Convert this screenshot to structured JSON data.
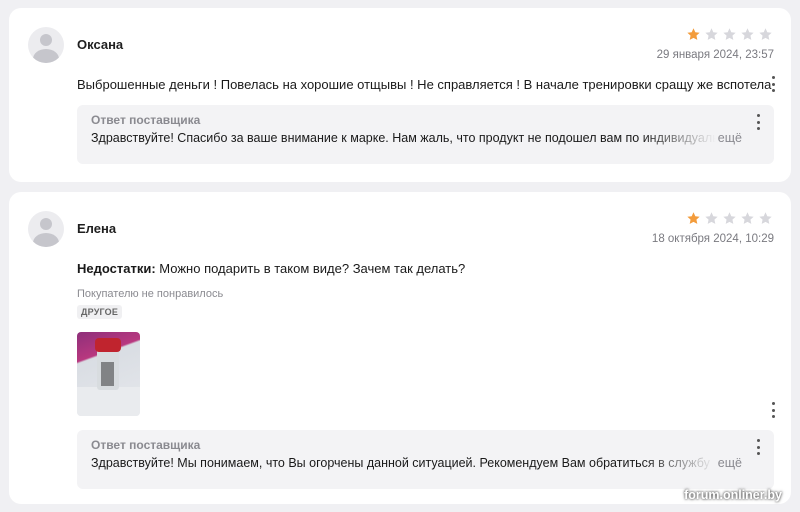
{
  "reviews": [
    {
      "author": "Оксана",
      "rating": 1,
      "max_rating": 5,
      "date": "29 января 2024, 23:57",
      "text": "Выброшенные деньги ! Повелась на хорошие отщывы ! Не справляется ! В начале тренировки сращу же вспотела",
      "reply": {
        "title": "Ответ поставщика",
        "text": "Здравствуйте! Спасибо за ваше внимание к марке. Нам жаль, что продукт не подошел вам по индивидуальным",
        "more": "ещё"
      }
    },
    {
      "author": "Елена",
      "rating": 1,
      "max_rating": 5,
      "date": "18 октября 2024, 10:29",
      "cons_label": "Недостатки:",
      "cons_text": "Можно подарить в таком виде? Зачем так делать?",
      "dislike_label": "Покупателю не понравилось",
      "tag": "ДРУГОЕ",
      "reply": {
        "title": "Ответ поставщика",
        "text": "Здравствуйте! Мы понимаем, что Вы огорчены данной ситуацией. Рекомендуем Вам обратиться в службу",
        "more": "ещё"
      }
    }
  ],
  "colors": {
    "star_filled": "#f39c3c",
    "star_empty": "#d7d7dc"
  },
  "watermark": "forum.onliner.by"
}
